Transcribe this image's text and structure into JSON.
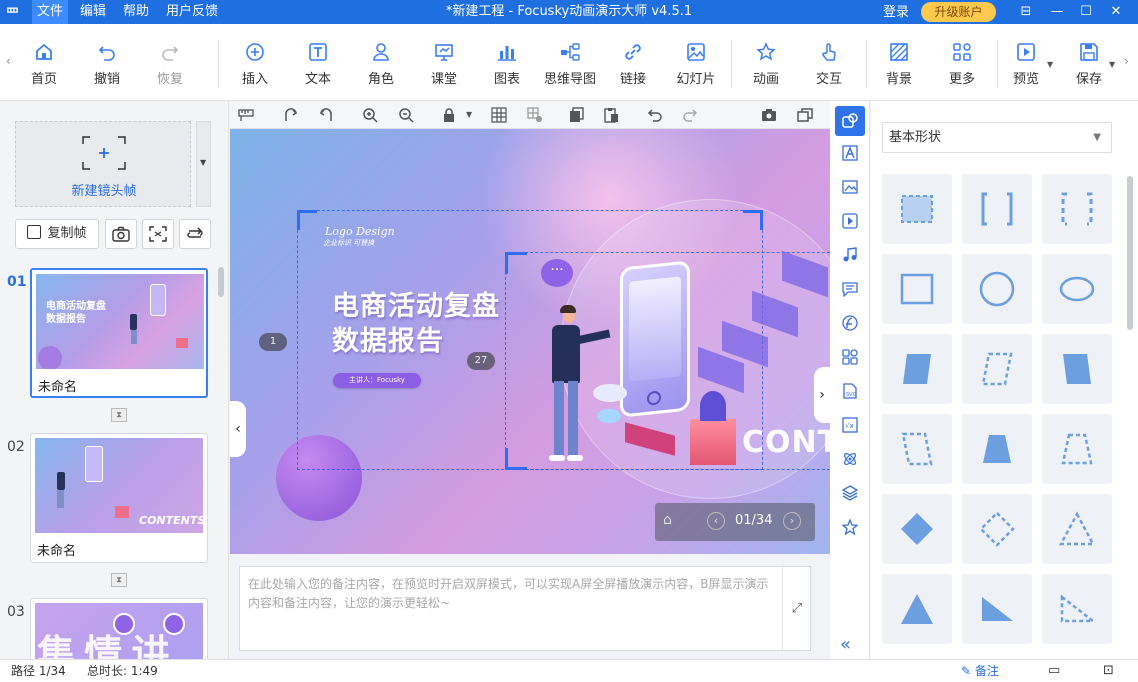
{
  "titlebar": {
    "logo": "罒",
    "menus": [
      "文件",
      "编辑",
      "帮助",
      "用户反馈"
    ],
    "title": "*新建工程 - Focusky动画演示大师  v4.5.1",
    "login": "登录",
    "upgrade": "升级账户",
    "win_buttons": [
      "⊟",
      "—",
      "☐",
      "✕"
    ]
  },
  "toolbar": {
    "items": [
      {
        "label": "首页",
        "icon": "home-icon"
      },
      {
        "label": "撤销",
        "icon": "undo-icon"
      },
      {
        "label": "恢复",
        "icon": "redo-icon"
      },
      {
        "label": "插入",
        "icon": "insert-icon"
      },
      {
        "label": "文本",
        "icon": "text-icon"
      },
      {
        "label": "角色",
        "icon": "role-icon"
      },
      {
        "label": "课堂",
        "icon": "classroom-icon"
      },
      {
        "label": "图表",
        "icon": "chart-icon"
      },
      {
        "label": "思维导图",
        "icon": "mindmap-icon"
      },
      {
        "label": "链接",
        "icon": "link-icon"
      },
      {
        "label": "幻灯片",
        "icon": "slide-icon"
      },
      {
        "label": "动画",
        "icon": "animation-icon"
      },
      {
        "label": "交互",
        "icon": "interaction-icon"
      },
      {
        "label": "背景",
        "icon": "background-icon"
      },
      {
        "label": "更多",
        "icon": "more-icon"
      },
      {
        "label": "预览",
        "icon": "preview-icon"
      },
      {
        "label": "保存",
        "icon": "save-icon"
      }
    ]
  },
  "left": {
    "new_frame": "新建镜头帧",
    "copy_frame": "复制帧",
    "slides": [
      {
        "num": "01",
        "name": "未命名",
        "title_line1": "电商活动复盘",
        "title_line2": "数据报告"
      },
      {
        "num": "02",
        "name": "未命名",
        "thumb_text": "CONTENTS"
      },
      {
        "num": "03",
        "name": ""
      }
    ]
  },
  "stage": {
    "logo_title": "Logo Design",
    "logo_sub": "企业标识 可替换",
    "heading1": "电商活动复盘",
    "heading2": "数据报告",
    "presenter": "主讲人：Focusky",
    "badge1": "1",
    "badge2": "27",
    "contents": "CONTENTS",
    "page_indicator": "01/34"
  },
  "notes": {
    "placeholder": "在此处输入您的备注内容，在预览时开启双屏模式，可以实现A屏全屏播放演示内容，B屏显示演示内容和备注内容，让您的演示更轻松~"
  },
  "shapes": {
    "category": "基本形状",
    "items": [
      "dashed-rect",
      "bracket",
      "corner-bracket",
      "rect",
      "circle",
      "ellipse",
      "parallelogram",
      "dashed-parallelogram",
      "trapezoid-slant",
      "dashed-parallelogram-2",
      "trapezoid",
      "dashed-trapezoid",
      "diamond",
      "dashed-diamond",
      "dashed-triangle",
      "triangle",
      "right-triangle",
      "dashed-right-triangle"
    ]
  },
  "status": {
    "path": "路径 1/34",
    "total": "总时长: 1:49",
    "notes_btn": "备注"
  },
  "colors": {
    "accent": "#1f6fe0",
    "upgrade": "#ffc94d",
    "shape_fill": "#6c9fe0"
  }
}
